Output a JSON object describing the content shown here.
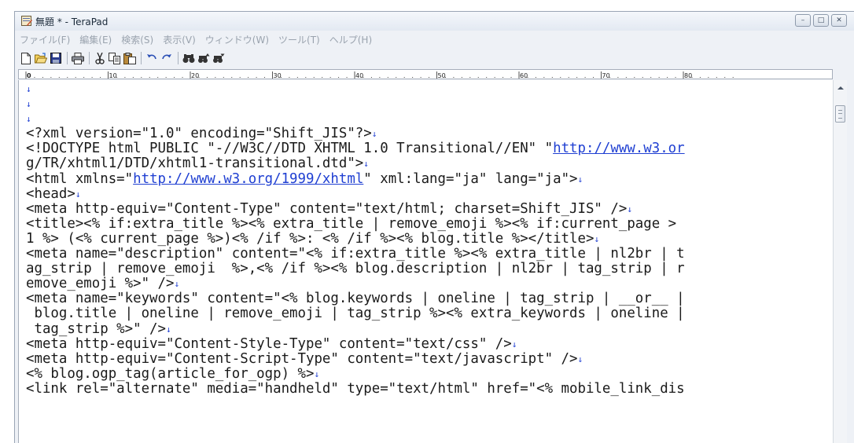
{
  "window": {
    "title": "無題 * - TeraPad"
  },
  "window_buttons": {
    "minimize": "–",
    "maximize": "□",
    "close": "✕"
  },
  "menu": [
    {
      "label": "ファイル(F)"
    },
    {
      "label": "編集(E)"
    },
    {
      "label": "検索(S)"
    },
    {
      "label": "表示(V)"
    },
    {
      "label": "ウィンドウ(W)"
    },
    {
      "label": "ツール(T)"
    },
    {
      "label": "ヘルプ(H)"
    }
  ],
  "toolbar": [
    {
      "icon": "new-file-icon"
    },
    {
      "icon": "open-folder-icon"
    },
    {
      "icon": "save-icon"
    },
    {
      "icon": "print-icon"
    },
    {
      "icon": "cut-icon"
    },
    {
      "icon": "copy-icon"
    },
    {
      "icon": "paste-icon"
    },
    {
      "icon": "undo-icon"
    },
    {
      "icon": "redo-icon"
    },
    {
      "icon": "find-icon"
    },
    {
      "icon": "find-next-icon"
    },
    {
      "icon": "find-prev-icon"
    }
  ],
  "ruler": {
    "labels": [
      "0",
      "10",
      "20",
      "30",
      "40",
      "50",
      "60",
      "70",
      "80"
    ]
  },
  "editor": {
    "eol_mark": "↓",
    "lines": [
      [
        {
          "t": ""
        }
      ],
      [
        {
          "t": ""
        }
      ],
      [
        {
          "t": ""
        }
      ],
      [
        {
          "t": "<?xml version=\"1.0\" encoding=\"Shift_JIS\"?>"
        }
      ],
      [
        {
          "t": "<!DOCTYPE html PUBLIC \"-//W3C//DTD XHTML 1.0 Transitional//EN\" \""
        },
        {
          "t": "http://www.w3.or",
          "url": true
        }
      ],
      [
        {
          "t": "g/TR/xhtml1/DTD/xhtml1-transitional.dtd\">"
        }
      ],
      [
        {
          "t": "<html xmlns=\""
        },
        {
          "t": "http://www.w3.org/1999/xhtml",
          "url": true
        },
        {
          "t": "\" xml:lang=\"ja\" lang=\"ja\">"
        }
      ],
      [
        {
          "t": "<head>"
        }
      ],
      [
        {
          "t": "<meta http-equiv=\"Content-Type\" content=\"text/html; charset=Shift_JIS\" />"
        }
      ],
      [
        {
          "t": "<title><% if:extra_title %><% extra_title | remove_emoji %><% if:current_page >"
        }
      ],
      [
        {
          "t": "1 %> (<% current_page %>)<% /if %>: <% /if %><% blog.title %></title>"
        }
      ],
      [
        {
          "t": "<meta name=\"description\" content=\"<% if:extra_title %><% extra_title | nl2br | t"
        }
      ],
      [
        {
          "t": "ag_strip | remove_emoji  %>,<% /if %><% blog.description | nl2br | tag_strip | r"
        }
      ],
      [
        {
          "t": "emove_emoji %>\" />"
        }
      ],
      [
        {
          "t": "<meta name=\"keywords\" content=\"<% blog.keywords | oneline | tag_strip | __or__ |"
        }
      ],
      [
        {
          "t": " blog.title | oneline | remove_emoji | tag_strip %><% extra_keywords | oneline |"
        }
      ],
      [
        {
          "t": " tag_strip %>\" />"
        }
      ],
      [
        {
          "t": "<meta http-equiv=\"Content-Style-Type\" content=\"text/css\" />"
        }
      ],
      [
        {
          "t": "<meta http-equiv=\"Content-Script-Type\" content=\"text/javascript\" />"
        }
      ],
      [
        {
          "t": "<% blog.ogp_tag(article_for_ogp) %>"
        }
      ],
      [
        {
          "t": "<link rel=\"alternate\" media=\"handheld\" type=\"text/html\" href=\"<% mobile_link_dis"
        }
      ]
    ],
    "eol_flags": [
      true,
      true,
      true,
      true,
      false,
      true,
      true,
      true,
      true,
      false,
      true,
      false,
      false,
      true,
      false,
      false,
      true,
      true,
      true,
      true,
      false
    ]
  }
}
